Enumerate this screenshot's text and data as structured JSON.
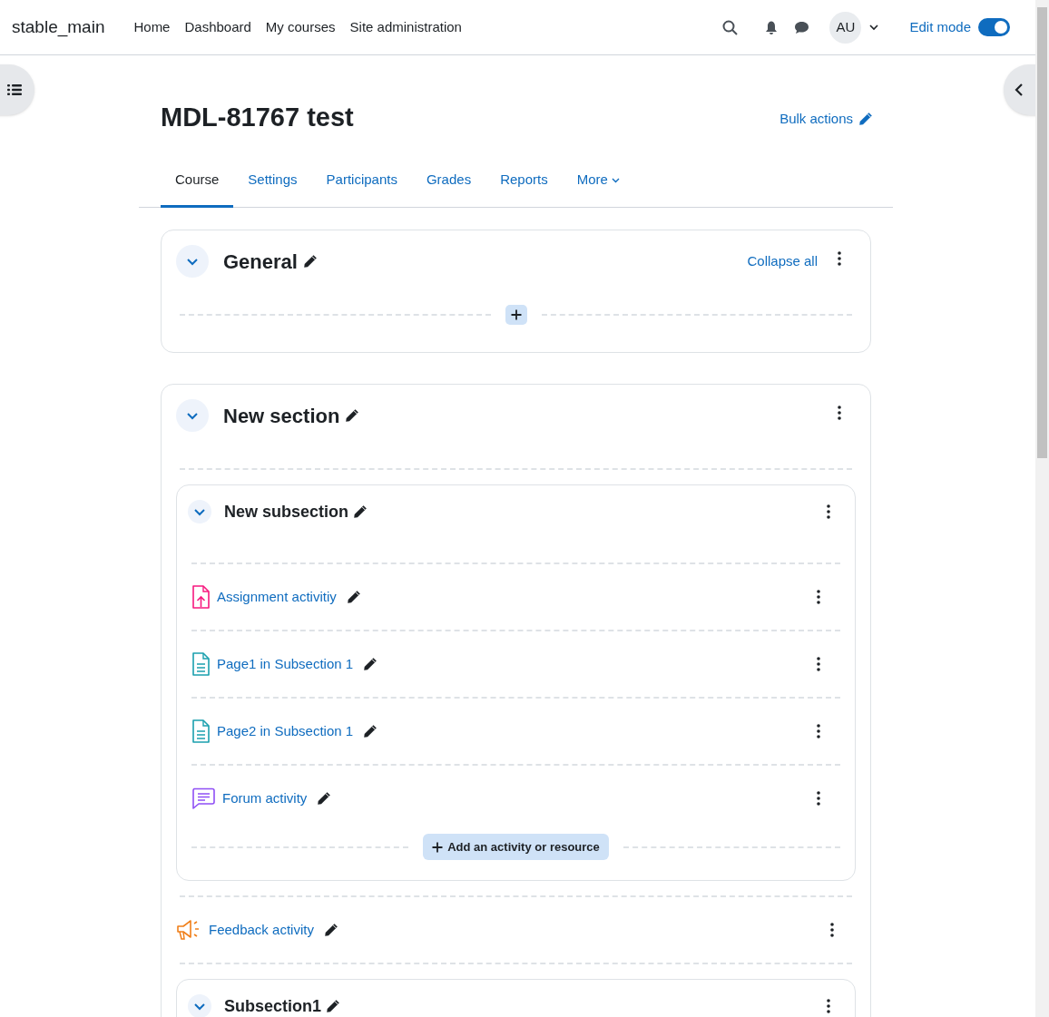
{
  "navbar": {
    "brand": "stable_main",
    "links": [
      "Home",
      "Dashboard",
      "My courses",
      "Site administration"
    ],
    "avatar": "AU",
    "edit_mode": {
      "label": "Edit mode",
      "on": true
    }
  },
  "course": {
    "title": "MDL-81767 test",
    "bulk_actions": "Bulk actions"
  },
  "tabs": [
    {
      "label": "Course",
      "selected": true,
      "kind": "link"
    },
    {
      "label": "Settings",
      "selected": false,
      "kind": "link"
    },
    {
      "label": "Participants",
      "selected": false,
      "kind": "link"
    },
    {
      "label": "Grades",
      "selected": false,
      "kind": "link"
    },
    {
      "label": "Reports",
      "selected": false,
      "kind": "link"
    },
    {
      "label": "More",
      "selected": false,
      "kind": "dropdown"
    }
  ],
  "sections": [
    {
      "title": "General",
      "expanded": true,
      "collapse_all": "Collapse all"
    },
    {
      "title": "New section",
      "expanded": true,
      "items": [
        {
          "kind": "subsection",
          "title": "New subsection",
          "expanded": true,
          "add_button": "Add an activity or resource",
          "items": [
            {
              "kind": "assign",
              "name": "Assignment activitiy"
            },
            {
              "kind": "page",
              "name": "Page1 in Subsection 1"
            },
            {
              "kind": "page",
              "name": "Page2 in Subsection 1"
            },
            {
              "kind": "forum",
              "name": "Forum activity"
            }
          ]
        },
        {
          "kind": "feedback",
          "name": "Feedback activity"
        },
        {
          "kind": "subsection",
          "title": "Subsection1",
          "expanded": true
        }
      ]
    }
  ]
}
